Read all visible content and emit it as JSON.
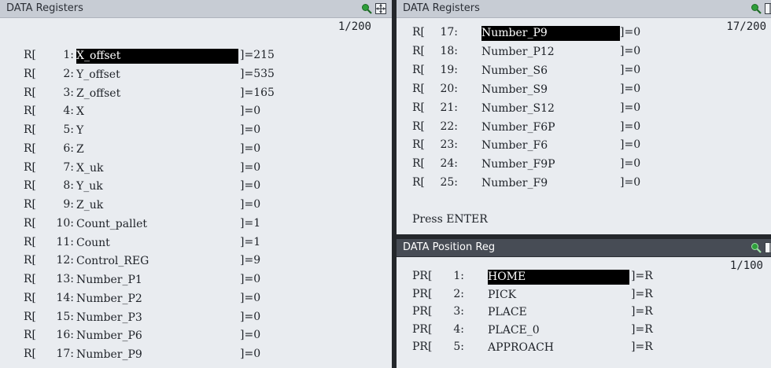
{
  "left_panel": {
    "title": "DATA Registers",
    "page": "1/200",
    "rows": [
      {
        "prefix": "R[",
        "num": "1:",
        "name": "X_offset",
        "value": "]=215",
        "selected": true
      },
      {
        "prefix": "R[",
        "num": "2:",
        "name": "Y_offset",
        "value": "]=535"
      },
      {
        "prefix": "R[",
        "num": "3:",
        "name": "Z_offset",
        "value": "]=165"
      },
      {
        "prefix": "R[",
        "num": "4:",
        "name": "X",
        "value": "]=0"
      },
      {
        "prefix": "R[",
        "num": "5:",
        "name": "Y",
        "value": "]=0"
      },
      {
        "prefix": "R[",
        "num": "6:",
        "name": "Z",
        "value": "]=0"
      },
      {
        "prefix": "R[",
        "num": "7:",
        "name": "X_uk",
        "value": "]=0"
      },
      {
        "prefix": "R[",
        "num": "8:",
        "name": "Y_uk",
        "value": "]=0"
      },
      {
        "prefix": "R[",
        "num": "9:",
        "name": "Z_uk",
        "value": "]=0"
      },
      {
        "prefix": "R[",
        "num": "10:",
        "name": "Count_pallet",
        "value": "]=1"
      },
      {
        "prefix": "R[",
        "num": "11:",
        "name": "Count",
        "value": "]=1"
      },
      {
        "prefix": "R[",
        "num": "12:",
        "name": "Control_REG",
        "value": "]=9"
      },
      {
        "prefix": "R[",
        "num": "13:",
        "name": "Number_P1",
        "value": "]=0"
      },
      {
        "prefix": "R[",
        "num": "14:",
        "name": "Number_P2",
        "value": "]=0"
      },
      {
        "prefix": "R[",
        "num": "15:",
        "name": "Number_P3",
        "value": "]=0"
      },
      {
        "prefix": "R[",
        "num": "16:",
        "name": "Number_P6",
        "value": "]=0"
      },
      {
        "prefix": "R[",
        "num": "17:",
        "name": "Number_P9",
        "value": "]=0"
      }
    ]
  },
  "right_top_panel": {
    "title": "DATA Registers",
    "page": "17/200",
    "rows": [
      {
        "prefix": "R[",
        "num": "17:",
        "name": "Number_P9",
        "value": "]=0",
        "selected": true
      },
      {
        "prefix": "R[",
        "num": "18:",
        "name": "Number_P12",
        "value": "]=0"
      },
      {
        "prefix": "R[",
        "num": "19:",
        "name": "Number_S6",
        "value": "]=0"
      },
      {
        "prefix": "R[",
        "num": "20:",
        "name": "Number_S9",
        "value": "]=0"
      },
      {
        "prefix": "R[",
        "num": "21:",
        "name": "Number_S12",
        "value": "]=0"
      },
      {
        "prefix": "R[",
        "num": "22:",
        "name": "Number_F6P",
        "value": "]=0"
      },
      {
        "prefix": "R[",
        "num": "23:",
        "name": "Number_F6",
        "value": "]=0"
      },
      {
        "prefix": "R[",
        "num": "24:",
        "name": "Number_F9P",
        "value": "]=0"
      },
      {
        "prefix": "R[",
        "num": "25:",
        "name": "Number_F9",
        "value": "]=0"
      }
    ],
    "prompt": "Press ENTER"
  },
  "right_bottom_panel": {
    "title": "DATA Position Reg",
    "page": "1/100",
    "rows": [
      {
        "prefix": "PR[",
        "num": "1:",
        "name": "HOME",
        "value": "]=R",
        "selected": true
      },
      {
        "prefix": "PR[",
        "num": "2:",
        "name": "PICK",
        "value": "]=R"
      },
      {
        "prefix": "PR[",
        "num": "3:",
        "name": "PLACE",
        "value": "]=R"
      },
      {
        "prefix": "PR[",
        "num": "4:",
        "name": "PLACE_0",
        "value": "]=R"
      },
      {
        "prefix": "PR[",
        "num": "5:",
        "name": "APPROACH",
        "value": "]=R"
      }
    ]
  },
  "icons": {
    "zoom": "zoom-icon",
    "maximize": "maximize-icon",
    "zoom_color": "#2e9e3a"
  }
}
